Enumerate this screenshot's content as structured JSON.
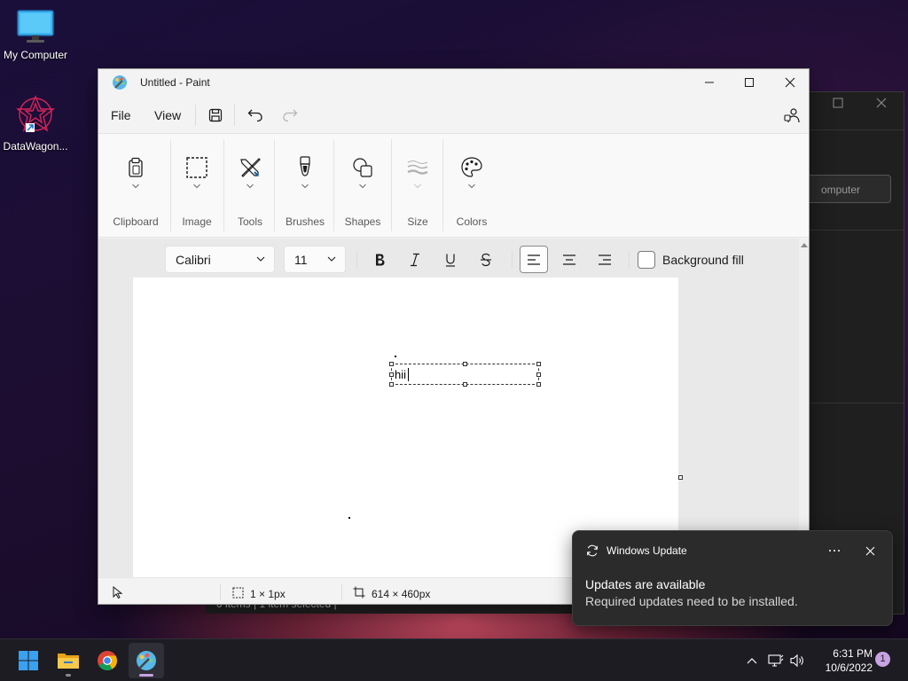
{
  "desktop": {
    "icons": [
      {
        "label": "My Computer"
      },
      {
        "label": "DataWagon..."
      }
    ]
  },
  "background_window": {
    "field_text": "omputer",
    "status_text": "0 items  |  1 item selected  |"
  },
  "paint": {
    "title": "Untitled - Paint",
    "menu": {
      "file": "File",
      "view": "View"
    },
    "ribbon_groups": [
      "Clipboard",
      "Image",
      "Tools",
      "Brushes",
      "Shapes",
      "Size",
      "Colors"
    ],
    "text_toolbar": {
      "font": "Calibri",
      "size": "11",
      "background_fill_label": "Background fill",
      "background_fill_checked": false,
      "alignment": "left"
    },
    "canvas": {
      "typed_text": "hii"
    },
    "status": {
      "selection_size": "1 × 1px",
      "canvas_size": "614 × 460px"
    }
  },
  "notification": {
    "app": "Windows Update",
    "title": "Updates are available",
    "body": "Required updates need to be installed."
  },
  "taskbar": {
    "pinned": [
      "start-icon",
      "file-explorer-icon",
      "chrome-icon",
      "paint-icon"
    ],
    "active": "paint-icon",
    "clock_time": "6:31 PM",
    "clock_date": "10/6/2022",
    "notification_count": "1"
  },
  "colors": {
    "accent": "#0067c0",
    "taskbar": "#1c1c22",
    "toast": "#2b2b2b",
    "badge": "#c8a2e3"
  }
}
